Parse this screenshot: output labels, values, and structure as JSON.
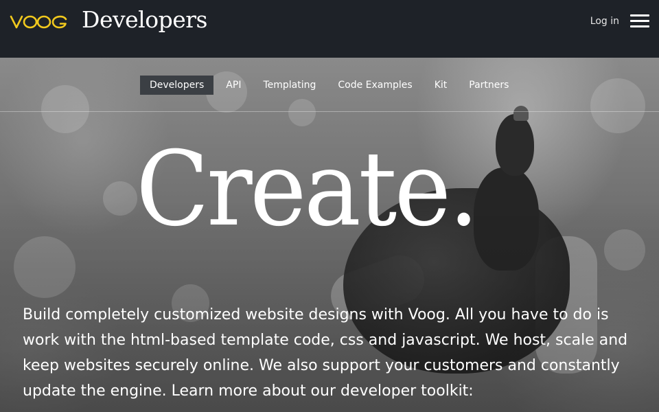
{
  "header": {
    "logo_text": "VOOG",
    "title": "Developers",
    "login_label": "Log in",
    "menu_icon": "hamburger-menu-icon"
  },
  "nav": {
    "items": [
      {
        "label": "Developers",
        "active": true
      },
      {
        "label": "API",
        "active": false
      },
      {
        "label": "Templating",
        "active": false
      },
      {
        "label": "Code Examples",
        "active": false
      },
      {
        "label": "Kit",
        "active": false
      },
      {
        "label": "Partners",
        "active": false
      }
    ]
  },
  "hero": {
    "headline": "Create.",
    "intro": "Build completely customized website designs with Voog. All you have to do is work with the html-based template code, css and javascript. We host, scale and keep websites securely online. We also support your customers and constantly update the engine. Learn more about our developer toolkit:"
  },
  "colors": {
    "topbar_bg": "#1e2228",
    "logo_accent": "#f2c91d",
    "nav_active_bg": "#3b3f44",
    "text": "#ffffff"
  }
}
